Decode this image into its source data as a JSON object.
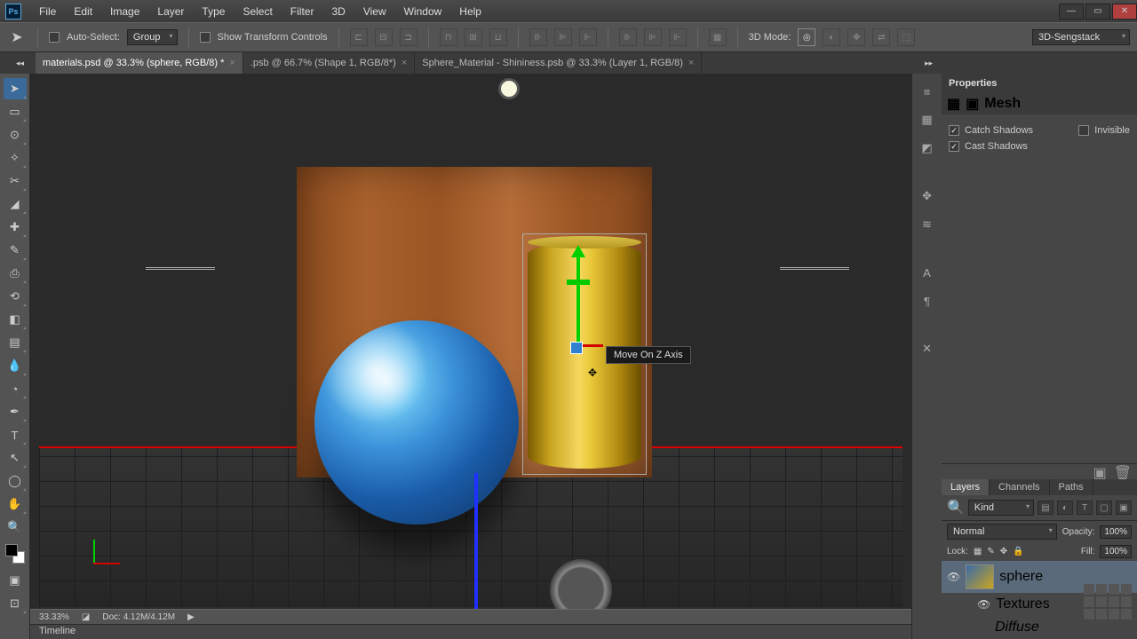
{
  "app": {
    "icon_text": "Ps"
  },
  "menu": [
    "File",
    "Edit",
    "Image",
    "Layer",
    "Type",
    "Select",
    "Filter",
    "3D",
    "View",
    "Window",
    "Help"
  ],
  "options": {
    "auto_select": "Auto-Select:",
    "group": "Group",
    "show_transform": "Show Transform Controls",
    "mode_label": "3D Mode:",
    "workspace": "3D-Sengstack"
  },
  "tabs": [
    {
      "label": "materials.psd @ 33.3% (sphere, RGB/8) *",
      "active": true
    },
    {
      "label": ".psb @ 66.7% (Shape 1, RGB/8*)",
      "active": false
    },
    {
      "label": "Sphere_Material - Shininess.psb @ 33.3% (Layer 1, RGB/8)",
      "active": false
    }
  ],
  "tooltip": "Move On Z Axis",
  "status": {
    "zoom": "33.33%",
    "doc": "Doc: 4.12M/4.12M"
  },
  "timeline_label": "Timeline",
  "properties": {
    "title": "Properties",
    "mesh_label": "Mesh",
    "catch_shadows": "Catch Shadows",
    "cast_shadows": "Cast Shadows",
    "invisible": "Invisible"
  },
  "layers": {
    "tabs": [
      "Layers",
      "Channels",
      "Paths"
    ],
    "kind": "Kind",
    "blend": "Normal",
    "opacity_label": "Opacity:",
    "opacity_val": "100%",
    "lock_label": "Lock:",
    "fill_label": "Fill:",
    "fill_val": "100%",
    "layer_name": "sphere",
    "textures": "Textures",
    "diffuse": "Diffuse"
  }
}
